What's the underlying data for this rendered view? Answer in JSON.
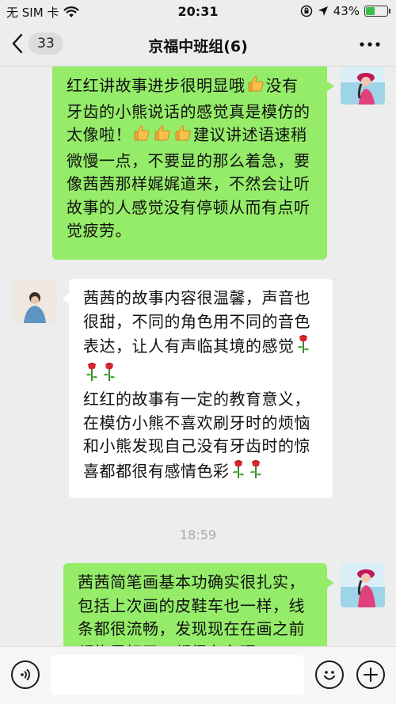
{
  "status_bar": {
    "carrier": "无 SIM 卡",
    "time": "20:31",
    "battery_percent": "43%",
    "battery_level": 0.43
  },
  "nav": {
    "unread_count": "33",
    "title": "京福中班组(6)"
  },
  "messages": [
    {
      "direction": "out",
      "segments": [
        "红红讲故事进步很明显哦",
        "thumbs-up",
        "没有牙齿的小熊说话的感觉真是模仿的太像啦！",
        "thumbs-up",
        "thumbs-up",
        "thumbs-up",
        "建议讲述语速稍微慢一点，不要显的那么着急，要像茜茜那样娓娓道来，不然会让听故事的人感觉没有停顿从而有点听觉疲劳。"
      ]
    },
    {
      "direction": "in",
      "segments": [
        "茜茜的故事内容很温馨，声音也很甜，不同的角色用不同的音色表达，让人有声临其境的感觉",
        "rose",
        "rose",
        "rose",
        "\n红红的故事有一定的教育意义，在模仿小熊不喜欢刷牙时的烦恼和小熊发现自己没有牙齿时的惊喜都都很有感情色彩",
        "rose",
        "rose"
      ]
    },
    {
      "direction": "out",
      "segments": [
        "茜茜简笔画基本功确实很扎实，包括上次画的皮鞋车也一样，线条都很流畅，发现现在在画之前都构思好了，都很有条理"
      ]
    }
  ],
  "time_divider": "18:59",
  "input": {
    "placeholder": ""
  },
  "icons": {
    "voice": "voice-icon",
    "emoji": "emoji-icon",
    "add": "plus-icon",
    "thumbs_up": "thumbs-up-emoji",
    "rose": "rose-emoji"
  },
  "colors": {
    "outgoing_bubble": "#95ec69",
    "incoming_bubble": "#ffffff",
    "background": "#ededed",
    "battery": "#35c24a"
  }
}
